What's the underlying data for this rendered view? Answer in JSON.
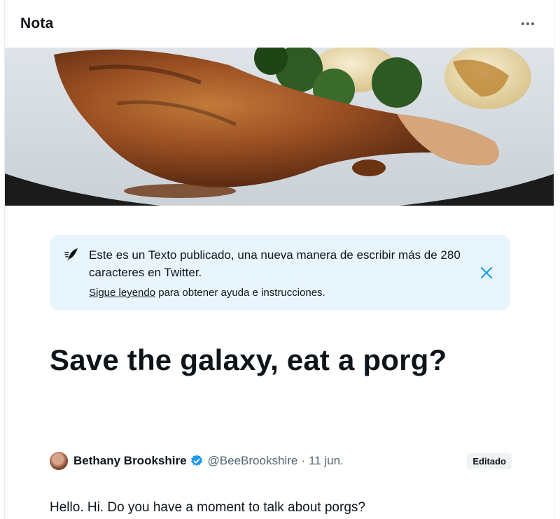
{
  "header": {
    "title": "Nota"
  },
  "notice": {
    "text": "Este es un Texto publicado, una nueva manera de escribir más de 280 caracteres en Twitter.",
    "link_label": "Sigue leyendo",
    "help_rest": " para obtener ayuda e instrucciones."
  },
  "article": {
    "title": "Save the galaxy, eat a porg?",
    "author_name": "Bethany Brookshire",
    "author_handle": "@BeeBrookshire",
    "separator": "·",
    "date": "11 jun.",
    "edited_badge": "Editado",
    "body": "Hello. Hi. Do you have a moment to talk about porgs?"
  },
  "icons": {
    "more": "more-horizontal-icon",
    "quill": "quill-icon",
    "close": "close-icon",
    "verified": "verified-badge-icon"
  },
  "colors": {
    "accent": "#1d9bf0",
    "notice_bg": "#e8f5fd",
    "muted_text": "#536471"
  }
}
